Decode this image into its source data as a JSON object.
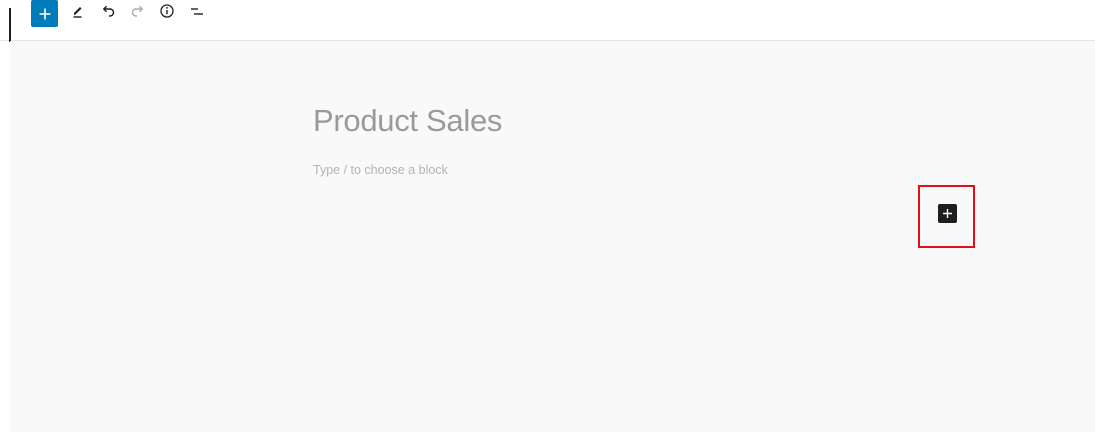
{
  "toolbar": {
    "accent_color": "#007cba",
    "tools": [
      {
        "name": "add-block",
        "icon": "plus-icon"
      },
      {
        "name": "edit",
        "icon": "pencil-icon"
      },
      {
        "name": "undo",
        "icon": "undo-icon"
      },
      {
        "name": "redo",
        "icon": "redo-icon"
      },
      {
        "name": "details",
        "icon": "info-icon"
      },
      {
        "name": "list-view",
        "icon": "list-view-icon"
      }
    ]
  },
  "editor": {
    "title": "Product Sales",
    "block_placeholder": "Type / to choose a block",
    "inserter_icon": "plus-icon",
    "highlight_color": "#e0111b"
  }
}
